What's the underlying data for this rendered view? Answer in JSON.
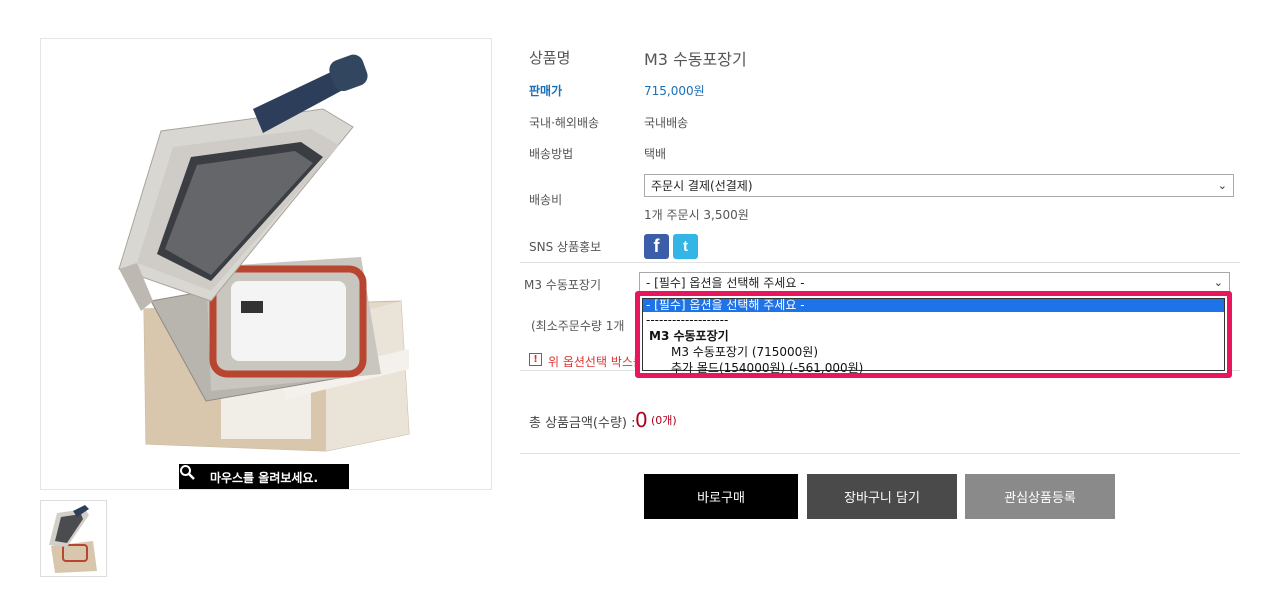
{
  "product": {
    "name_label": "상품명",
    "name_value": "M3 수동포장기",
    "price_label": "판매가",
    "price_value": "715,000원",
    "shipping_region_label": "국내·해외배송",
    "shipping_region_value": "국내배송",
    "shipping_method_label": "배송방법",
    "shipping_method_value": "택배",
    "shipping_fee_label": "배송비",
    "shipping_fee_select": "주문시 결제(선결제)",
    "shipping_fee_note": "1개 주문시 3,500원",
    "sns_label": "SNS 상품홍보",
    "sns_icons": [
      "facebook-icon",
      "twitter-icon"
    ]
  },
  "image": {
    "zoom_hint": "마우스를 올려보세요."
  },
  "option": {
    "label": "M3 수동포장기",
    "select_value": "- [필수] 옵션을 선택해 주세요 -",
    "dropdown_items": [
      "- [필수] 옵션을 선택해 주세요 -",
      "-------------------",
      "M3 수동포장기",
      "M3 수동포장기 (715000원)",
      "추가 몰드(154000원) (-561,000원)"
    ],
    "min_order_text": "(최소주문수량 1개",
    "warning_text": "위 옵션선택 박스를"
  },
  "total": {
    "label": "총 상품금액(수량) :",
    "amount": "0",
    "qty": "(0개)"
  },
  "buttons": {
    "buy": "바로구매",
    "cart": "장바구니 담기",
    "wishlist": "관심상품등록"
  },
  "colors": {
    "accent_price": "#1a6fb5",
    "highlight_border": "#e8175d",
    "total_red": "#b0001c"
  }
}
